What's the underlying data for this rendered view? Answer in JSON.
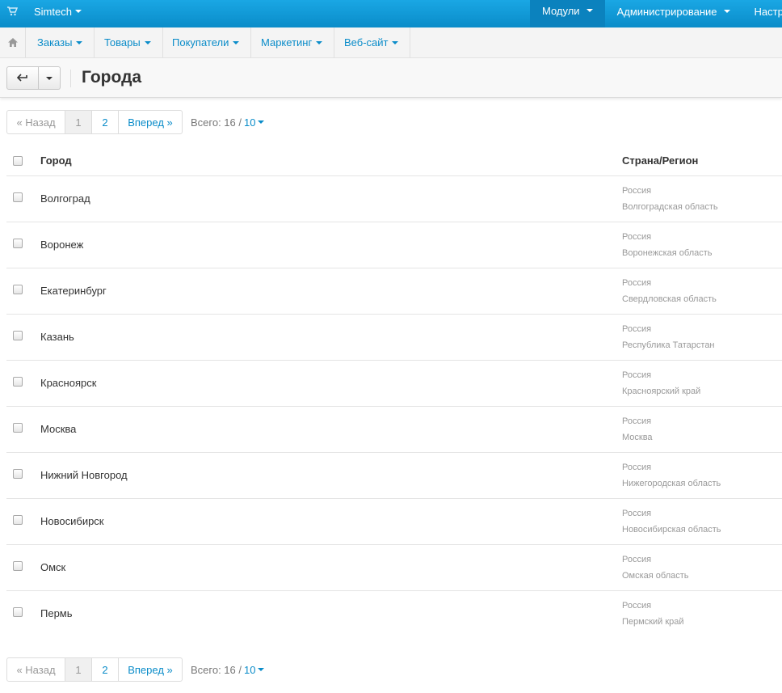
{
  "topbar": {
    "brand": "Simtech",
    "menu": [
      {
        "label": "Модули"
      },
      {
        "label": "Администрирование"
      },
      {
        "label": "Настройки"
      }
    ]
  },
  "nav": {
    "items": [
      {
        "label": "Заказы"
      },
      {
        "label": "Товары"
      },
      {
        "label": "Покупатели"
      },
      {
        "label": "Маркетинг"
      },
      {
        "label": "Веб-сайт"
      }
    ]
  },
  "page": {
    "title": "Города"
  },
  "pagination": {
    "prev": "« Назад",
    "pages": [
      "1",
      "2"
    ],
    "current": "1",
    "next": "Вперед »",
    "total_label": "Всего: 16 /",
    "per_page": "10"
  },
  "table": {
    "headers": {
      "city": "Город",
      "country": "Страна/Регион"
    },
    "rows": [
      {
        "city": "Волгоград",
        "country": "Россия",
        "region": "Волгоградская область"
      },
      {
        "city": "Воронеж",
        "country": "Россия",
        "region": "Воронежская область"
      },
      {
        "city": "Екатеринбург",
        "country": "Россия",
        "region": "Свердловская область"
      },
      {
        "city": "Казань",
        "country": "Россия",
        "region": "Республика Татарстан"
      },
      {
        "city": "Красноярск",
        "country": "Россия",
        "region": "Красноярский край"
      },
      {
        "city": "Москва",
        "country": "Россия",
        "region": "Москва"
      },
      {
        "city": "Нижний Новгород",
        "country": "Россия",
        "region": "Нижегородская область"
      },
      {
        "city": "Новосибирск",
        "country": "Россия",
        "region": "Новосибирская область"
      },
      {
        "city": "Омск",
        "country": "Россия",
        "region": "Омская область"
      },
      {
        "city": "Пермь",
        "country": "Россия",
        "region": "Пермский край"
      }
    ]
  },
  "icons": {
    "cart": "shopping-cart-icon",
    "home": "home-icon",
    "back": "back-arrow-icon"
  },
  "colors": {
    "topbar": "#0c97d6",
    "link": "#0a8cc9"
  }
}
